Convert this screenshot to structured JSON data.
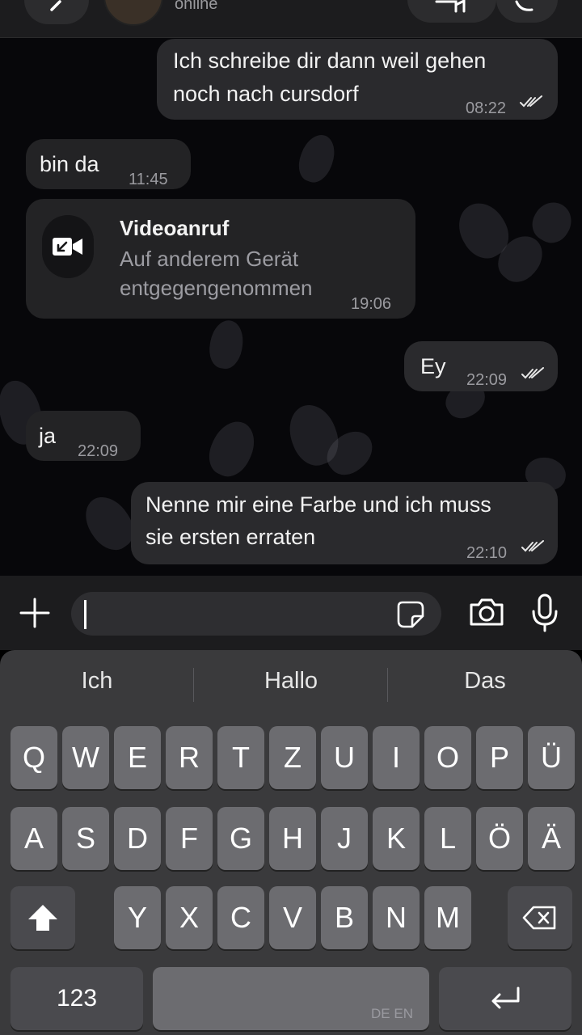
{
  "header": {
    "status": "online"
  },
  "messages": [
    {
      "direction": "out",
      "text1": "Ich schreibe dir dann weil gehen",
      "text2": "noch nach cursdorf",
      "time": "08:22"
    },
    {
      "direction": "in",
      "text1": "bin da",
      "time": "11:45"
    },
    {
      "direction": "in",
      "type": "call",
      "title": "Videoanruf",
      "subtitle1": "Auf anderem Gerät",
      "subtitle2": "entgegengenommen",
      "time": "19:06"
    },
    {
      "direction": "out",
      "text1": "Ey",
      "time": "22:09"
    },
    {
      "direction": "in",
      "text1": "ja",
      "time": "22:09"
    },
    {
      "direction": "out",
      "text1": "Nenne mir eine Farbe und ich muss",
      "text2": "sie ersten erraten",
      "time": "22:10"
    }
  ],
  "input": {
    "value": "",
    "placeholder": ""
  },
  "icons": {
    "attach": "plus-icon",
    "sticker": "sticker-icon",
    "camera": "camera-icon",
    "mic": "microphone-icon",
    "call": "video-call-icon"
  },
  "keyboard": {
    "suggestions": [
      "Ich",
      "Hallo",
      "Das"
    ],
    "row1": [
      "Q",
      "W",
      "E",
      "R",
      "T",
      "Z",
      "U",
      "I",
      "O",
      "P",
      "Ü"
    ],
    "row2": [
      "A",
      "S",
      "D",
      "F",
      "G",
      "H",
      "J",
      "K",
      "L",
      "Ö",
      "Ä"
    ],
    "row3": [
      "Y",
      "X",
      "C",
      "V",
      "B",
      "N",
      "M"
    ],
    "numbers_label": "123",
    "language_label": "DE EN"
  },
  "colors": {
    "chat_background": "#07070a",
    "bubble_out": "#2a2a2d",
    "bubble_in": "#232325",
    "keyboard_background": "#3a3a3c",
    "key": "#6c6c70"
  }
}
